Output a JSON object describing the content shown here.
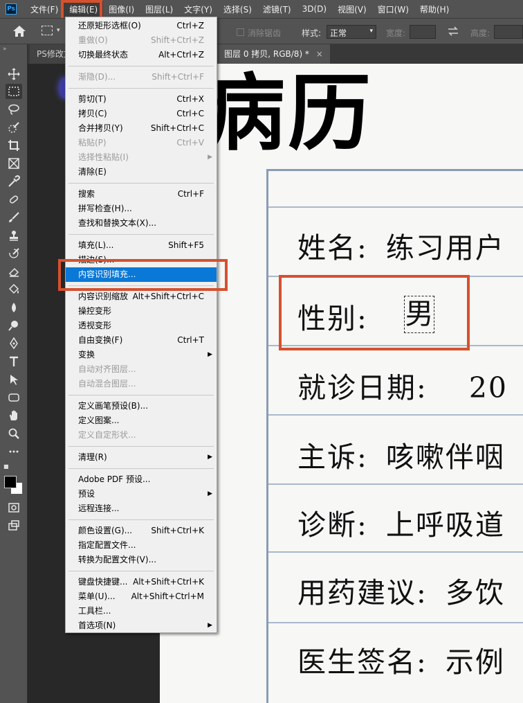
{
  "app_logo": "Ps",
  "menubar": {
    "items": [
      "文件(F)",
      "编辑(E)",
      "图像(I)",
      "图层(L)",
      "文字(Y)",
      "选择(S)",
      "滤镜(T)",
      "3D(D)",
      "视图(V)",
      "窗口(W)",
      "帮助(H)"
    ],
    "active": "编辑(E)"
  },
  "options_bar": {
    "antialias_label": "消除锯齿",
    "style_label": "样式:",
    "style_value": "正常",
    "width_label": "宽度:",
    "height_label": "高度:"
  },
  "tabs": [
    {
      "label": "PS修改文",
      "active": false
    },
    {
      "label": "图层 0 拷贝, RGB/8) *",
      "active": true,
      "close": "×"
    }
  ],
  "toolbar": {
    "tools": [
      "move-icon",
      "rectangular-marquee-icon",
      "lasso-icon",
      "quick-selection-icon",
      "crop-icon",
      "frame-icon",
      "eyedropper-icon",
      "spot-healing-icon",
      "brush-icon",
      "stamp-icon",
      "history-brush-icon",
      "eraser-icon",
      "paint-bucket-icon",
      "blur-icon",
      "dodge-icon",
      "pen-icon",
      "type-icon",
      "path-selection-icon",
      "rectangle-icon",
      "hand-icon",
      "zoom-icon",
      "more-icon",
      "quick-mask-icon",
      "screen-mode-icon"
    ],
    "active_tool": "rectangular-marquee-icon",
    "foreground_color": "#000000",
    "background_color": "#ffffff"
  },
  "edit_menu": {
    "groups": [
      [
        {
          "label": "还原矩形选框(O)",
          "shortcut": "Ctrl+Z",
          "enabled": true
        },
        {
          "label": "重做(O)",
          "shortcut": "Shift+Ctrl+Z",
          "enabled": false
        },
        {
          "label": "切换最终状态",
          "shortcut": "Alt+Ctrl+Z",
          "enabled": true
        }
      ],
      [
        {
          "label": "渐隐(D)...",
          "shortcut": "Shift+Ctrl+F",
          "enabled": false
        }
      ],
      [
        {
          "label": "剪切(T)",
          "shortcut": "Ctrl+X",
          "enabled": true
        },
        {
          "label": "拷贝(C)",
          "shortcut": "Ctrl+C",
          "enabled": true
        },
        {
          "label": "合并拷贝(Y)",
          "shortcut": "Shift+Ctrl+C",
          "enabled": true
        },
        {
          "label": "粘贴(P)",
          "shortcut": "Ctrl+V",
          "enabled": false
        },
        {
          "label": "选择性粘贴(I)",
          "shortcut": "",
          "enabled": false,
          "submenu": true
        },
        {
          "label": "清除(E)",
          "shortcut": "",
          "enabled": true
        }
      ],
      [
        {
          "label": "搜索",
          "shortcut": "Ctrl+F",
          "enabled": true
        },
        {
          "label": "拼写检查(H)...",
          "shortcut": "",
          "enabled": true
        },
        {
          "label": "查找和替换文本(X)...",
          "shortcut": "",
          "enabled": true
        }
      ],
      [
        {
          "label": "填充(L)...",
          "shortcut": "Shift+F5",
          "enabled": true
        },
        {
          "label": "描边(S)...",
          "shortcut": "",
          "enabled": true
        },
        {
          "label": "内容识别填充...",
          "shortcut": "",
          "enabled": true,
          "highlighted": true
        }
      ],
      [
        {
          "label": "内容识别缩放",
          "shortcut": "Alt+Shift+Ctrl+C",
          "enabled": true
        },
        {
          "label": "操控变形",
          "shortcut": "",
          "enabled": true
        },
        {
          "label": "透视变形",
          "shortcut": "",
          "enabled": true
        },
        {
          "label": "自由变换(F)",
          "shortcut": "Ctrl+T",
          "enabled": true
        },
        {
          "label": "变换",
          "shortcut": "",
          "enabled": true,
          "submenu": true
        },
        {
          "label": "自动对齐图层...",
          "shortcut": "",
          "enabled": false
        },
        {
          "label": "自动混合图层...",
          "shortcut": "",
          "enabled": false
        }
      ],
      [
        {
          "label": "定义画笔预设(B)...",
          "shortcut": "",
          "enabled": true
        },
        {
          "label": "定义图案...",
          "shortcut": "",
          "enabled": true
        },
        {
          "label": "定义自定形状...",
          "shortcut": "",
          "enabled": false
        }
      ],
      [
        {
          "label": "清理(R)",
          "shortcut": "",
          "enabled": true,
          "submenu": true
        }
      ],
      [
        {
          "label": "Adobe PDF 预设...",
          "shortcut": "",
          "enabled": true
        },
        {
          "label": "预设",
          "shortcut": "",
          "enabled": true,
          "submenu": true
        },
        {
          "label": "远程连接...",
          "shortcut": "",
          "enabled": true
        }
      ],
      [
        {
          "label": "颜色设置(G)...",
          "shortcut": "Shift+Ctrl+K",
          "enabled": true
        },
        {
          "label": "指定配置文件...",
          "shortcut": "",
          "enabled": true
        },
        {
          "label": "转换为配置文件(V)...",
          "shortcut": "",
          "enabled": true
        }
      ],
      [
        {
          "label": "键盘快捷键...",
          "shortcut": "Alt+Shift+Ctrl+K",
          "enabled": true
        },
        {
          "label": "菜单(U)...",
          "shortcut": "Alt+Shift+Ctrl+M",
          "enabled": true
        },
        {
          "label": "工具栏...",
          "shortcut": "",
          "enabled": true
        },
        {
          "label": "首选项(N)",
          "shortcut": "",
          "enabled": true,
          "submenu": true
        }
      ]
    ]
  },
  "document": {
    "title": "病历",
    "rows": [
      {
        "label": "姓名:",
        "value": "练习用户"
      },
      {
        "label": "性别:",
        "value": "男"
      },
      {
        "label": "就诊日期:",
        "value": "20"
      },
      {
        "label": "主诉:",
        "value": "咳嗽伴咽"
      },
      {
        "label": "诊断:",
        "value": "上呼吸道"
      },
      {
        "label": "用药建议:",
        "value": "多饮"
      },
      {
        "label": "医生签名:",
        "value": "示例"
      }
    ]
  },
  "annotation_color": "#d6502e",
  "highlight_color": "#0a78d7"
}
